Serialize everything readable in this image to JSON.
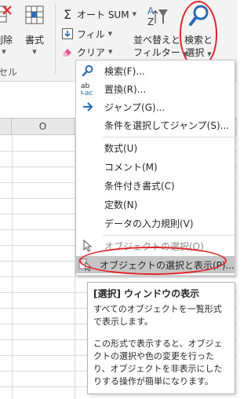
{
  "ribbon": {
    "delete_label": "削除",
    "format_label": "書式",
    "cell_group_label": "セル",
    "autosum_label": "オート SUM",
    "fill_label": "フィル",
    "clear_label": "クリア",
    "sort_line1": "並べ替えと",
    "sort_line2": "フィルター",
    "find_line1": "検索と",
    "find_line2": "選択"
  },
  "sheet": {
    "column_o": "O"
  },
  "menu": {
    "items": [
      {
        "label": "検索(F)...",
        "icon": "search-icon"
      },
      {
        "label": "置換(R)...",
        "icon": "replace-icon"
      },
      {
        "label": "ジャンプ(G)...",
        "icon": "arrow-right-icon"
      },
      {
        "label": "条件を選択してジャンプ(S)...",
        "icon": ""
      },
      {
        "label": "数式(U)",
        "icon": ""
      },
      {
        "label": "コメント(M)",
        "icon": ""
      },
      {
        "label": "条件付き書式(C)",
        "icon": ""
      },
      {
        "label": "定数(N)",
        "icon": ""
      },
      {
        "label": "データの入力規則(V)",
        "icon": ""
      },
      {
        "label": "オブジェクトの選択(O)",
        "icon": "pointer-icon"
      },
      {
        "label": "オブジェクトの選択と表示(P)...",
        "icon": "selection-pane-icon"
      }
    ]
  },
  "tooltip": {
    "title": "[選択] ウィンドウの表示",
    "para1": "すべてのオブジェクトを一覧形式で表示します。",
    "para2": "この形式で表示すると、オブジェクトの選択や色の変更を行ったり、オブジェクトを非表示にしたりする操作が簡単になります。"
  },
  "colors": {
    "accent_blue": "#2b6cb5",
    "highlight_circle": "#e3242b",
    "menu_highlight": "#c5c5c5"
  }
}
